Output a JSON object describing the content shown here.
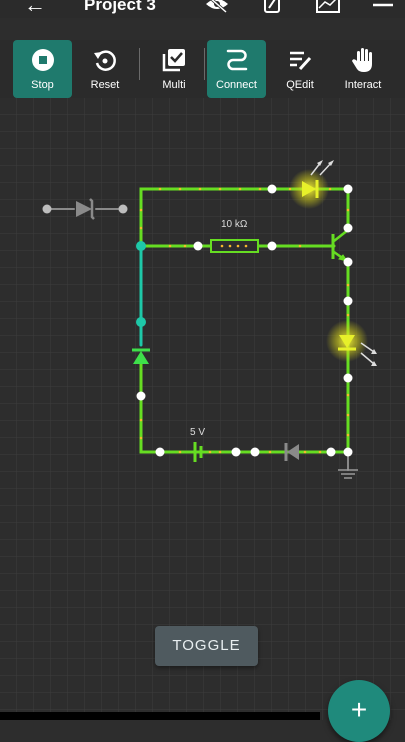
{
  "app_bar": {
    "back_icon": "back-arrow-icon",
    "title": "Project 3",
    "icons": [
      "visibility-off-icon",
      "probe-icon",
      "graph-icon",
      "menu-icon"
    ]
  },
  "toolbar": {
    "items": [
      {
        "label": "Stop",
        "icon": "stop-icon",
        "active": true
      },
      {
        "label": "Reset",
        "icon": "reset-icon",
        "active": false
      },
      {
        "label": "Multi",
        "icon": "multi-select-icon",
        "active": false
      },
      {
        "label": "Connect",
        "icon": "connect-icon",
        "active": true
      },
      {
        "label": "QEdit",
        "icon": "quick-edit-icon",
        "active": false
      },
      {
        "label": "Interact",
        "icon": "hand-icon",
        "active": false
      }
    ]
  },
  "circuit": {
    "resistor_label": "10 kΩ",
    "battery_label": "5 V"
  },
  "toggle_label": "TOGGLE",
  "fab_label": "+",
  "colors": {
    "accent": "#1f7a6d",
    "wire_active": "#66dd22",
    "wire_selected": "#1ec8a8",
    "current_dots": "#f5b82e",
    "led_glow": "#eef024",
    "node": "#ffffff"
  }
}
